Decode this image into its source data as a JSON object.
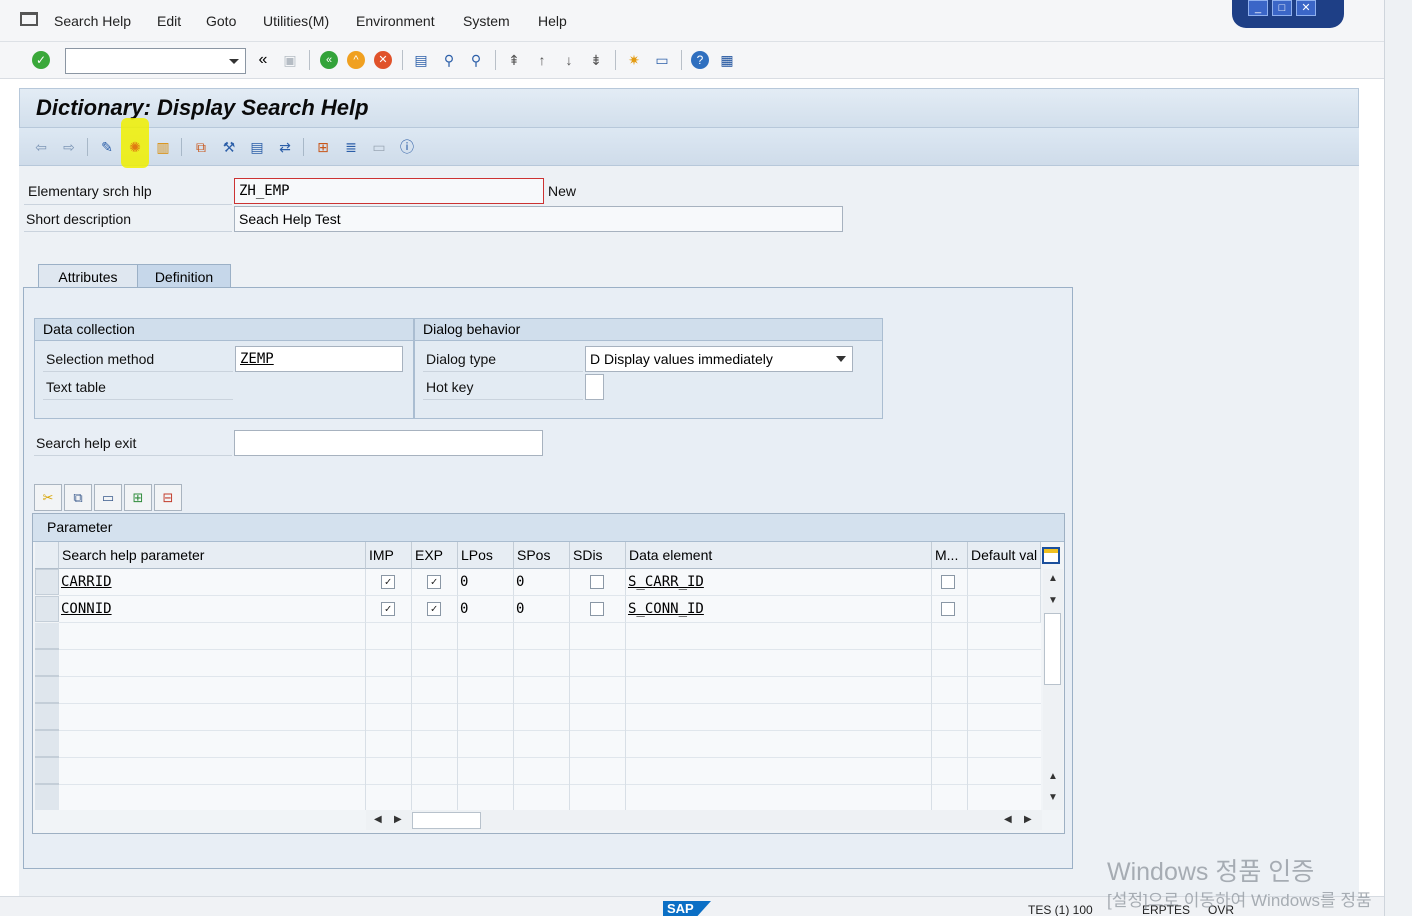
{
  "menu": {
    "items": [
      "Search Help",
      "Edit",
      "Goto",
      "Utilities(M)",
      "Environment",
      "System",
      "Help"
    ]
  },
  "window_controls": {
    "minimize": "_",
    "maximize": "□",
    "close": "✕"
  },
  "toolbar": {
    "command_field_value": "",
    "back_arrows": "«"
  },
  "header": {
    "title": "Dictionary: Display Search Help"
  },
  "form": {
    "elementary_label": "Elementary srch hlp",
    "elementary_value": "ZH_EMP",
    "elementary_status": "New",
    "short_desc_label": "Short description",
    "short_desc_value": "Seach Help Test"
  },
  "tabs": {
    "attributes": "Attributes",
    "definition": "Definition"
  },
  "data_collection": {
    "title": "Data collection",
    "selection_method_label": "Selection method",
    "selection_method_value": "ZEMP",
    "text_table_label": "Text table"
  },
  "dialog_behavior": {
    "title": "Dialog behavior",
    "dialog_type_label": "Dialog type",
    "dialog_type_value": "D Display values immediately",
    "hot_key_label": "Hot key"
  },
  "exit": {
    "label": "Search help exit",
    "value": ""
  },
  "param_table": {
    "title": "Parameter",
    "columns": [
      "Search help parameter",
      "IMP",
      "EXP",
      "LPos",
      "SPos",
      "SDis",
      "Data element",
      "M...",
      "Default val"
    ],
    "rows": [
      {
        "param": "CARRID",
        "imp": true,
        "exp": true,
        "lpos": "0",
        "spos": "0",
        "sdis": false,
        "data_element": "S_CARR_ID",
        "m": false,
        "default": ""
      },
      {
        "param": "CONNID",
        "imp": true,
        "exp": true,
        "lpos": "0",
        "spos": "0",
        "sdis": false,
        "data_element": "S_CONN_ID",
        "m": false,
        "default": ""
      }
    ]
  },
  "status_bar": {
    "logo": "SAP",
    "system": "TES (1) 100",
    "host": "ERPTES",
    "mode": "OVR"
  },
  "watermark": {
    "line1": "Windows 정품 인증",
    "line2": "[설정]으로 이동하여 Windows를 정품"
  },
  "colors": {
    "highlight": "#f0f000",
    "title_bg": "#d2dfec",
    "sap_blue": "#0b6fc5"
  }
}
